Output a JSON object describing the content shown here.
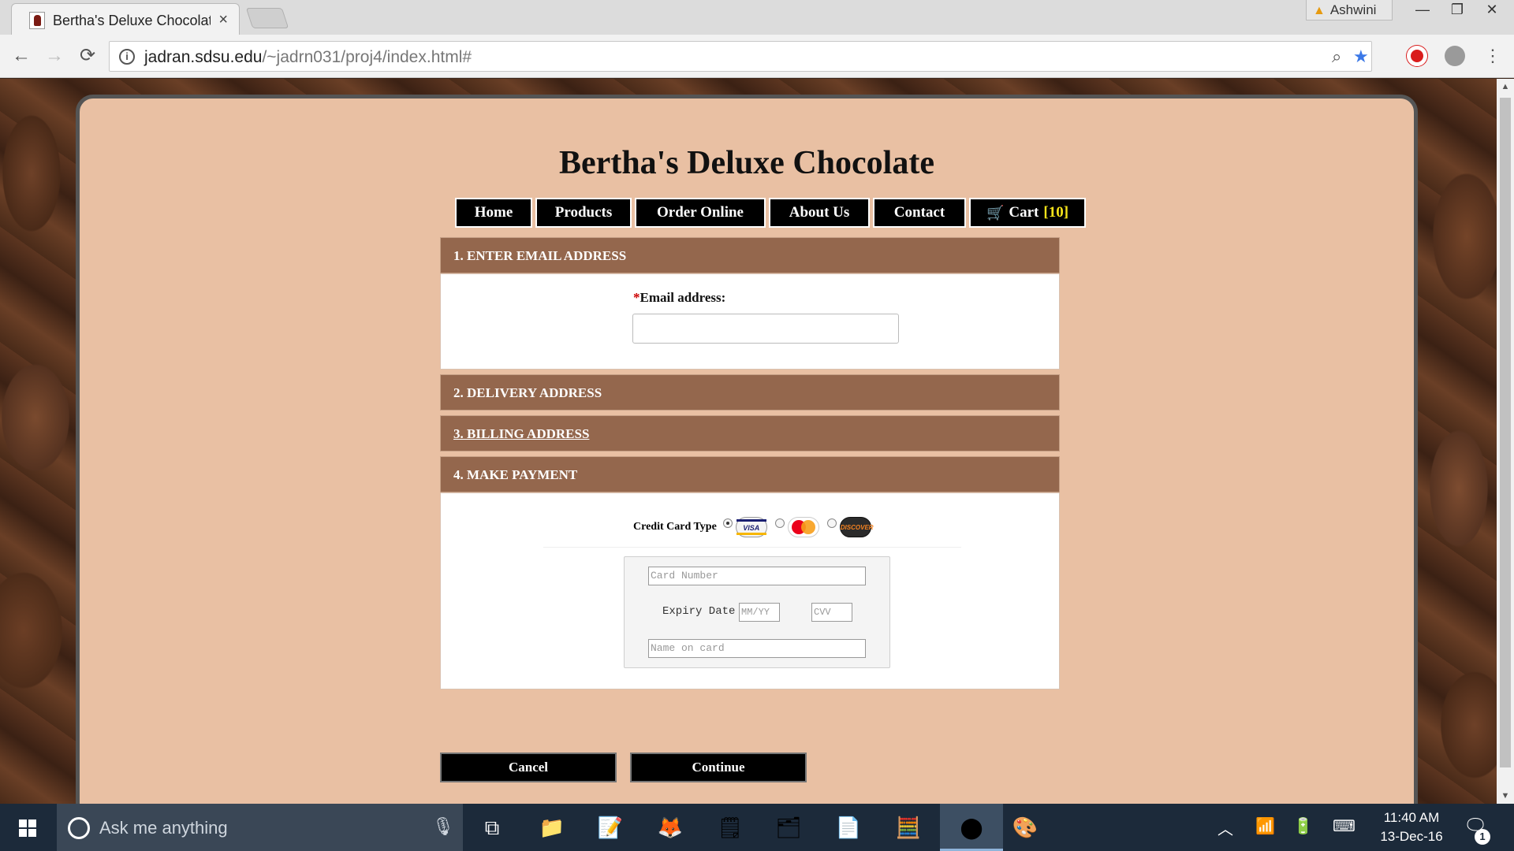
{
  "browser": {
    "tab_title": "Bertha's Deluxe Chocolat",
    "tab_close": "×",
    "profile_name": "Ashwini",
    "window_min": "—",
    "window_restore": "❐",
    "window_close": "✕",
    "back": "←",
    "forward": "→",
    "reload": "⟳",
    "url_host": "jadran.sdsu.edu",
    "url_path": "/~jadrn031/proj4/index.html#",
    "zoom_glyph": "⌕",
    "star_glyph": "★",
    "menu_glyph": "⋮"
  },
  "site": {
    "title": "Bertha's Deluxe Chocolate",
    "nav": {
      "home": "Home",
      "products": "Products",
      "order_online": "Order Online",
      "about_us": "About Us",
      "contact": "Contact",
      "cart": "Cart",
      "cart_count": "[10]"
    }
  },
  "checkout": {
    "sections": {
      "email": "1. ENTER EMAIL ADDRESS",
      "delivery": "2. DELIVERY ADDRESS",
      "billing": "3. BILLING ADDRESS",
      "payment": "4. MAKE PAYMENT"
    },
    "email": {
      "required_mark": "*",
      "label": "Email address:",
      "value": ""
    },
    "payment": {
      "card_type_label": "Credit Card Type",
      "selected_card": "visa",
      "card_brands": {
        "visa": "VISA",
        "mastercard": "",
        "discover": "DISCOVER"
      },
      "card_number_placeholder": "Card Number",
      "expiry_label": "Expiry Date",
      "expiry_placeholder": "MM/YY",
      "cvv_placeholder": "CVV",
      "name_placeholder": "Name on card"
    },
    "buttons": {
      "cancel": "Cancel",
      "continue": "Continue"
    }
  },
  "taskbar": {
    "search_placeholder": "Ask me anything",
    "time": "11:40 AM",
    "date": "13-Dec-16",
    "notification_count": "1"
  },
  "colors": {
    "page_bg": "#e9c0a3",
    "section_header": "#94674d",
    "nav_bg": "#000000",
    "cart_count": "#f5e21a",
    "required": "#cc0000"
  }
}
